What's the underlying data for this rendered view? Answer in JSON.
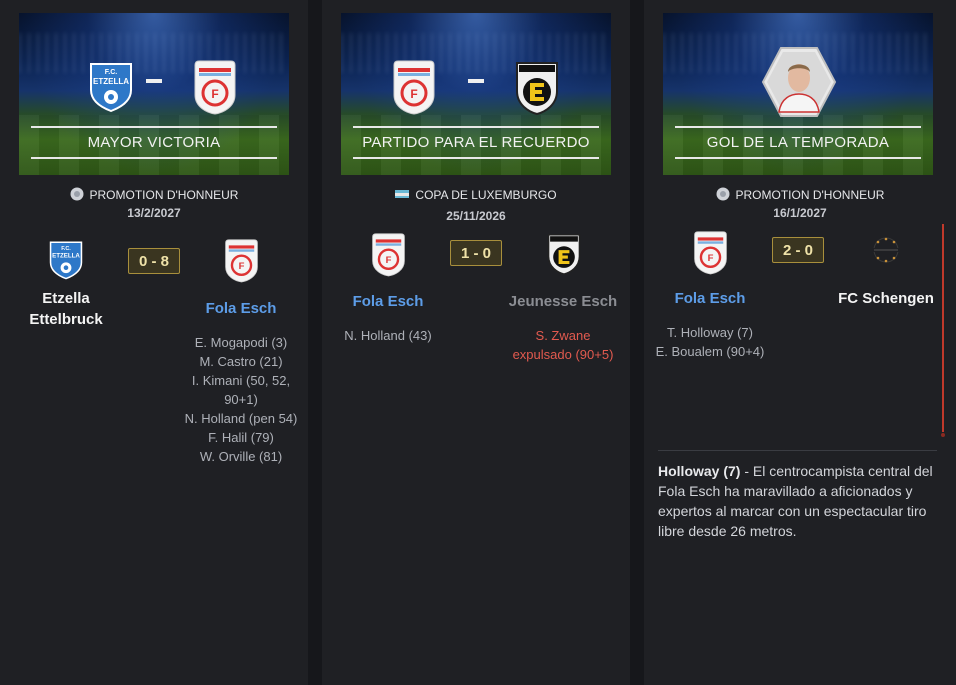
{
  "cards": [
    {
      "banner_title": "MAYOR VICTORIA",
      "competition": "PROMOTION D'HONNEUR",
      "date": "13/2/2027",
      "score": "0 - 8",
      "home_team": "Etzella Ettelbruck",
      "away_team": "Fola Esch",
      "home_events": [],
      "away_events": [
        "E. Mogapodi (3)",
        "M. Castro (21)",
        "I. Kimani (50, 52,",
        "90+1)",
        "N. Holland (pen 54)",
        "F. Halil (79)",
        "W. Orville (81)"
      ]
    },
    {
      "banner_title": "PARTIDO PARA EL RECUERDO",
      "competition": "COPA DE LUXEMBURGO",
      "date": "25/11/2026",
      "score": "1 - 0",
      "home_team": "Fola Esch",
      "away_team": "Jeunesse Esch",
      "home_events": [
        "N. Holland (43)"
      ],
      "away_events": [
        "S. Zwane",
        "expulsado (90+5)"
      ]
    },
    {
      "banner_title": "GOL DE LA TEMPORADA",
      "competition": "PROMOTION D'HONNEUR",
      "date": "16/1/2027",
      "score": "2 - 0",
      "home_team": "Fola Esch",
      "away_team": "FC Schengen",
      "home_events": [
        "T. Holloway (7)",
        "E. Boualem (90+4)"
      ],
      "away_events": [],
      "description_player": "Holloway (7)",
      "description_text": " - El centrocampista central del Fola Esch ha maravillado a aficionados y expertos al marcar con un espectacular tiro libre desde 26 metros."
    }
  ],
  "colors": {
    "home_highlight": "#5d9de8",
    "red_card": "#e25a4f",
    "score_border": "#a88f3c"
  },
  "icons": {
    "competition_league": "league-badge-icon",
    "competition_cup": "luxembourg-flag-icon",
    "etzella_crest": "etzella-crest-icon",
    "fola_crest": "fola-esch-crest-icon",
    "jeunesse_crest": "jeunesse-esch-crest-icon",
    "schengen_crest": "fc-schengen-crest-icon",
    "player_photo": "player-portrait-icon"
  }
}
